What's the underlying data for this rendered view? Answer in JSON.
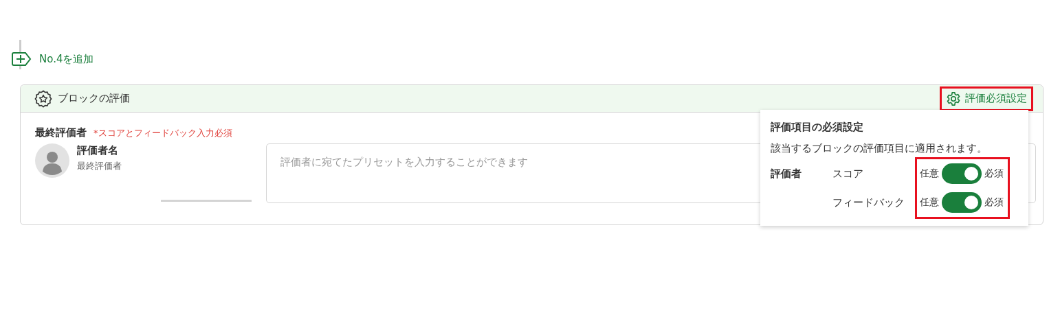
{
  "add_button": {
    "label": "No.4を追加"
  },
  "block": {
    "title": "ブロックの評価",
    "settings_button": {
      "label": "評価必須設定",
      "highlighted": true
    },
    "evaluator": {
      "heading": "最終評価者",
      "note": "*スコアとフィードバック入力必須",
      "name": "評価者名",
      "role": "最終評価者",
      "comment": {
        "placeholder": "評価者に宛てたプリセットを入力することができます"
      }
    }
  },
  "popover": {
    "title": "評価項目の必須設定",
    "description": "該当するブロックの評価項目に適用されます。",
    "group_label": "評価者",
    "toggles_highlighted": true,
    "rows": [
      {
        "label": "スコア",
        "off_label": "任意",
        "on_label": "必須",
        "on": true
      },
      {
        "label": "フィードバック",
        "off_label": "任意",
        "on_label": "必須",
        "on": true
      }
    ]
  }
}
